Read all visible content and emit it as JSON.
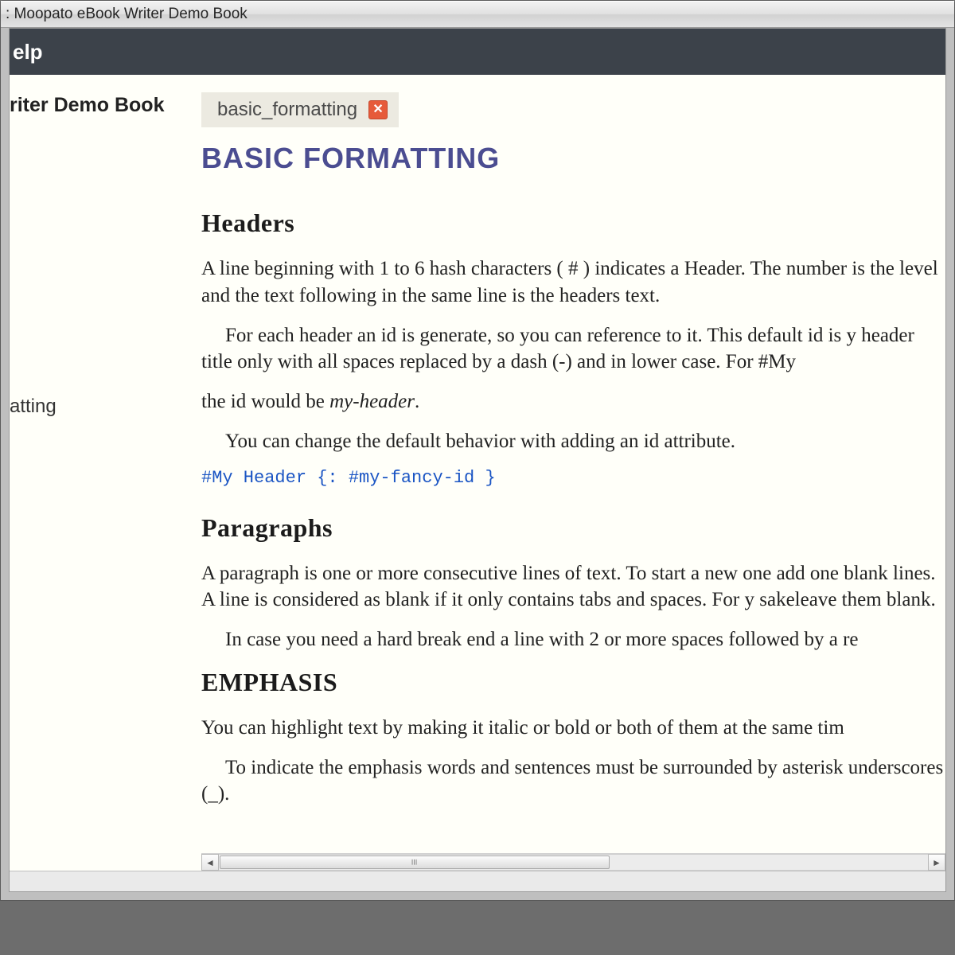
{
  "title_bar": ": Moopato eBook Writer Demo Book",
  "menubar": {
    "help": "elp"
  },
  "sidebar": {
    "book_title": "riter Demo Book",
    "items": [
      {
        "label": "",
        "active": false
      },
      {
        "label": "",
        "active": true
      },
      {
        "label": "",
        "active": false
      },
      {
        "label": "atting",
        "active": false
      }
    ]
  },
  "editor": {
    "tab": {
      "label": "basic_formatting"
    },
    "page_title": "BASIC FORMATTING",
    "sections": {
      "headers": {
        "heading": "Headers",
        "p1a": "A line beginning with 1 to 6 hash characters ( # ) indicates a Header. The number is the level and the text following in the same line is the headers text.",
        "p1b": "For each header an id is generate, so you can reference to it. This default id is y header title only with all spaces replaced by a dash (-) and in lower case. For #My",
        "p1c_prefix": "the id would be ",
        "p1c_em": "my-header",
        "p1c_suffix": ".",
        "p1d": "You can change the default behavior with adding an id attribute.",
        "code": "#My Header {: #my-fancy-id }"
      },
      "paragraphs": {
        "heading": "Paragraphs",
        "p1": "A paragraph is one or more consecutive lines of text. To start a new one add one blank lines. A line is considered as blank if it only contains tabs and spaces. For y sakeleave them blank.",
        "p2": "In case you need a hard break end a line with 2 or more spaces followed by a re"
      },
      "emphasis": {
        "heading": "EMPHASIS",
        "p1": "You can highlight text by making it italic or bold or both of them at the same tim",
        "p2": "To indicate the emphasis words and sentences must be surrounded by asterisk underscores (_)."
      }
    }
  }
}
